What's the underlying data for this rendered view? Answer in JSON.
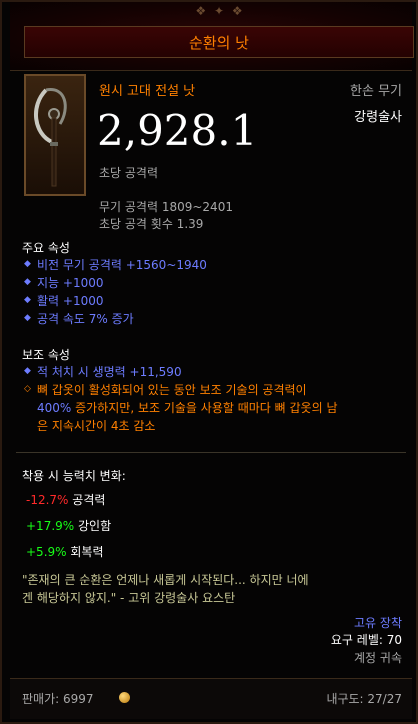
{
  "item": {
    "name": "순환의 낫",
    "quality_type": "원시 고대 전설 낫",
    "slot": "한손 무기",
    "class": "강령술사",
    "dps": "2,928.1",
    "dps_label": "초당 공격력",
    "damage_range": "무기 공격력 1809~2401",
    "attack_speed": "초당 공격 횟수 1.39"
  },
  "primary": {
    "title": "주요 속성",
    "stats": [
      "비전 무기 공격력 +1560~1940",
      "지능 +1000",
      "활력 +1000",
      "공격 속도 7% 증가"
    ]
  },
  "secondary": {
    "title": "보조 속성",
    "stats": [
      "적 처치 시 생명력 +11,590"
    ],
    "legendary_line1": "뼈 갑옷이 활성화되어 있는 동안 보조 기술의 공격력이",
    "legendary_line2_value": "400%",
    "legendary_line2_rest": " 증가하지만, 보조 기술을 사용할 때마다 뼈 갑옷의 남",
    "legendary_line3": "은 지속시간이 4초 감소"
  },
  "comparison": {
    "title": "착용 시 능력치 변화:",
    "rows": [
      {
        "value": "-12.7%",
        "label": "공격력"
      },
      {
        "value": "+17.9%",
        "label": "강인함"
      },
      {
        "value": "+5.9%",
        "label": "회복력"
      }
    ]
  },
  "flavor": {
    "line1": "\"존재의 큰 순환은 언제나 새롭게 시작된다... 하지만 너에",
    "line2": "겐 해당하지 않지.\" - 고위 강령술사 요스탄"
  },
  "meta": {
    "unique_equipped": "고유 장착",
    "required_level": "요구 레벨: 70",
    "account_bound": "계정 귀속"
  },
  "footer": {
    "sell_value": "판매가: 6997",
    "durability": "내구도: 27/27"
  },
  "colors": {
    "legendary": "#ff8000",
    "magic": "#6d7cff",
    "negative": "#ff2a2a",
    "positive": "#18ff18",
    "flavor": "#c8c896"
  },
  "icons": {
    "item": "scythe-icon",
    "bullet": "diamond-bullet-icon",
    "gold": "gold-coin-icon"
  }
}
